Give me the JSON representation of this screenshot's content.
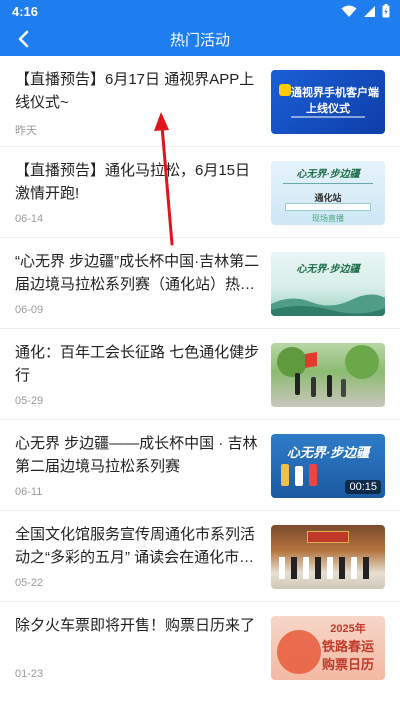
{
  "status_bar": {
    "time": "4:16"
  },
  "app_bar": {
    "title": "热门活动"
  },
  "colors": {
    "primary": "#1e7ef0",
    "annotation_arrow": "#e0141c"
  },
  "items": [
    {
      "title": "【直播预告】6月17日 通视界APP上线仪式~",
      "date": "昨天",
      "thumb": {
        "line1": "通视界手机客户端",
        "line2": "上线仪式"
      }
    },
    {
      "title": "【直播预告】通化马拉松，6月15日激情开跑!",
      "date": "06-14",
      "thumb": {
        "line1": "心无界·步边疆",
        "line2": "通化站",
        "line3": "现场直播"
      }
    },
    {
      "title": "“心无界 步边疆”成长杯中国·吉林第二届边境马拉松系列赛（通化站）热力来袭",
      "date": "06-09",
      "thumb": {
        "line1": "心无界·步边疆"
      }
    },
    {
      "title": "通化：百年工会长征路 七色通化健步行",
      "date": "05-29",
      "thumb": {}
    },
    {
      "title": "心无界 步边疆——成长杯中国 · 吉林第二届边境马拉松系列赛",
      "date": "06-11",
      "thumb": {
        "line1": "心无界·步边疆",
        "duration": "00:15"
      }
    },
    {
      "title": "全国文化馆服务宣传周通化市系列活动之“多彩的五月” 诵读会在通化市群众艺术馆举行",
      "date": "05-22",
      "thumb": {}
    },
    {
      "title": "除夕火车票即将开售！购票日历来了",
      "date": "01-23",
      "thumb": {
        "line1": "2025年",
        "line2": "铁路春运",
        "line3": "购票日历"
      }
    }
  ]
}
